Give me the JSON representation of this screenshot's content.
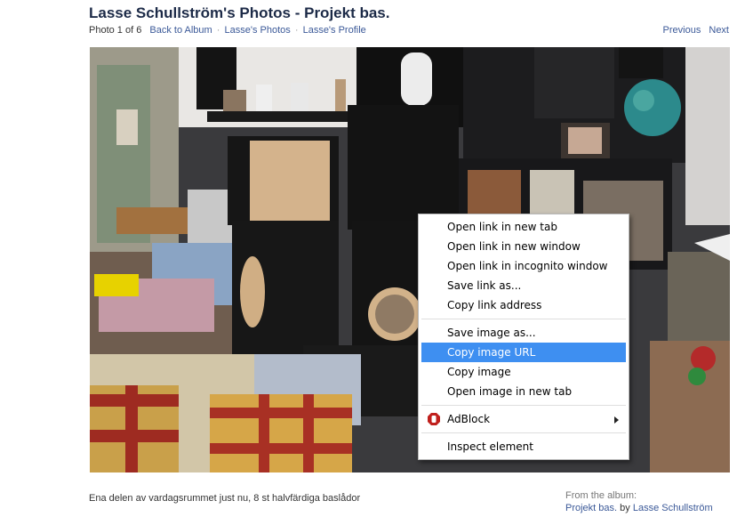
{
  "header": {
    "title": "Lasse Schullström's Photos - Projekt bas.",
    "photo_counter": "Photo 1 of 6",
    "links": {
      "back_to_album": "Back to Album",
      "owner_photos": "Lasse's Photos",
      "owner_profile": "Lasse's Profile"
    },
    "separator": "·",
    "pager": {
      "previous": "Previous",
      "next": "Next"
    }
  },
  "caption": "Ena delen av vardagsrummet just nu, 8 st halvfärdiga baslådor",
  "album": {
    "from_label": "From the album:",
    "album_name": "Projekt bas.",
    "by_label": "by",
    "owner_name": "Lasse Schullström"
  },
  "context_menu": {
    "groups": [
      [
        {
          "label": "Open link in new tab"
        },
        {
          "label": "Open link in new window"
        },
        {
          "label": "Open link in incognito window"
        },
        {
          "label": "Save link as..."
        },
        {
          "label": "Copy link address"
        }
      ],
      [
        {
          "label": "Save image as..."
        },
        {
          "label": "Copy image URL",
          "selected": true
        },
        {
          "label": "Copy image"
        },
        {
          "label": "Open image in new tab"
        }
      ],
      [
        {
          "label": "AdBlock",
          "icon": "adblock-icon",
          "submenu": true
        }
      ],
      [
        {
          "label": "Inspect element"
        }
      ]
    ]
  },
  "colors": {
    "link": "#3b5998",
    "title": "#1c2a47",
    "menu_highlight": "#3e8ff1",
    "adblock_red": "#c0201d"
  }
}
